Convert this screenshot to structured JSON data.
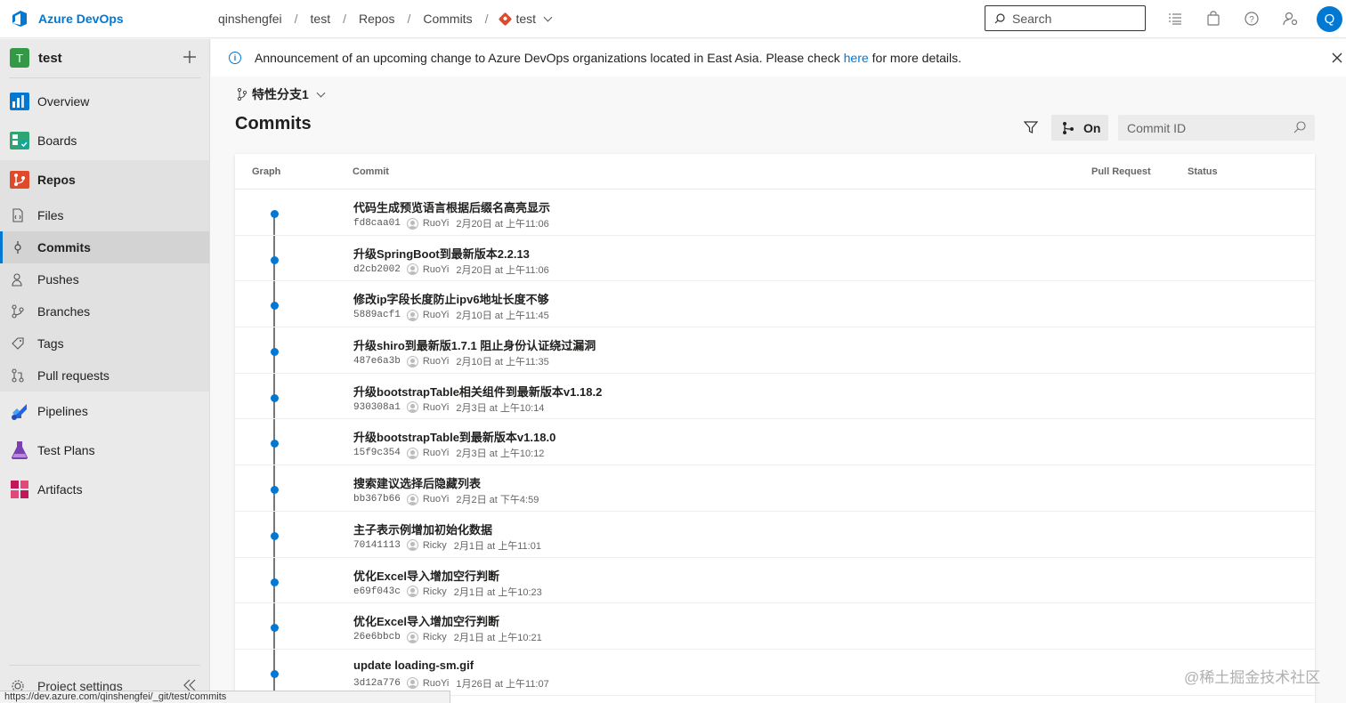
{
  "brand": {
    "name": "Azure DevOps"
  },
  "breadcrumb": [
    "qinshengfei",
    "test",
    "Repos",
    "Commits"
  ],
  "repo_crumb": "test",
  "search": {
    "placeholder": "Search"
  },
  "user": {
    "initial": "Q"
  },
  "project": {
    "badge": "T",
    "name": "test"
  },
  "nav": {
    "overview": "Overview",
    "boards": "Boards",
    "repos": "Repos",
    "files": "Files",
    "commits": "Commits",
    "pushes": "Pushes",
    "branches": "Branches",
    "tags": "Tags",
    "pull_requests": "Pull requests",
    "pipelines": "Pipelines",
    "test_plans": "Test Plans",
    "artifacts": "Artifacts",
    "project_settings": "Project settings"
  },
  "announcement": {
    "text_before": "Announcement of an upcoming change to Azure DevOps organizations located in East Asia. Please check",
    "link": "here",
    "text_after": "for more details."
  },
  "branch_selector": "特性分支1",
  "page_title": "Commits",
  "graph_toggle": "On",
  "commit_id": {
    "placeholder": "Commit ID"
  },
  "table": {
    "headers": {
      "graph": "Graph",
      "commit": "Commit",
      "pull_request": "Pull Request",
      "status": "Status"
    },
    "rows": [
      {
        "title": "代码生成预览语言根据后缀名高亮显示",
        "hash": "fd8caa01",
        "author": "RuoYi",
        "date": "2月20日 at 上午11:06"
      },
      {
        "title": "升级SpringBoot到最新版本2.2.13",
        "hash": "d2cb2002",
        "author": "RuoYi",
        "date": "2月20日 at 上午11:06"
      },
      {
        "title": "修改ip字段长度防止ipv6地址长度不够",
        "hash": "5889acf1",
        "author": "RuoYi",
        "date": "2月10日 at 上午11:45"
      },
      {
        "title": "升级shiro到最新版1.7.1 阻止身份认证绕过漏洞",
        "hash": "487e6a3b",
        "author": "RuoYi",
        "date": "2月10日 at 上午11:35"
      },
      {
        "title": "升级bootstrapTable相关组件到最新版本v1.18.2",
        "hash": "930308a1",
        "author": "RuoYi",
        "date": "2月3日 at 上午10:14"
      },
      {
        "title": "升级bootstrapTable到最新版本v1.18.0",
        "hash": "15f9c354",
        "author": "RuoYi",
        "date": "2月3日 at 上午10:12"
      },
      {
        "title": "搜索建议选择后隐藏列表",
        "hash": "bb367b66",
        "author": "RuoYi",
        "date": "2月2日 at 下午4:59"
      },
      {
        "title": "主子表示例增加初始化数据",
        "hash": "70141113",
        "author": "Ricky",
        "date": "2月1日 at 上午11:01"
      },
      {
        "title": "优化Excel导入增加空行判断",
        "hash": "e69f043c",
        "author": "Ricky",
        "date": "2月1日 at 上午10:23"
      },
      {
        "title": "优化Excel导入增加空行判断",
        "hash": "26e6bbcb",
        "author": "Ricky",
        "date": "2月1日 at 上午10:21"
      },
      {
        "title": "update loading-sm.gif",
        "hash": "3d12a776",
        "author": "RuoYi",
        "date": "1月26日 at 上午11:07"
      }
    ]
  },
  "status_url": "https://dev.azure.com/qinshengfei/_git/test/commits",
  "watermark": "@稀土掘金技术社区",
  "colors": {
    "accent": "#0078d4",
    "project_badge": "#339947",
    "repo_icon": "#e0492a"
  },
  "icons": [
    "azure-devops-logo-icon",
    "search-icon",
    "list-icon",
    "shopping-bag-icon",
    "help-icon",
    "user-settings-icon",
    "plus-icon",
    "info-icon",
    "close-icon",
    "branch-icon",
    "filter-icon",
    "graph-icon",
    "gear-icon",
    "collapse-icon"
  ]
}
